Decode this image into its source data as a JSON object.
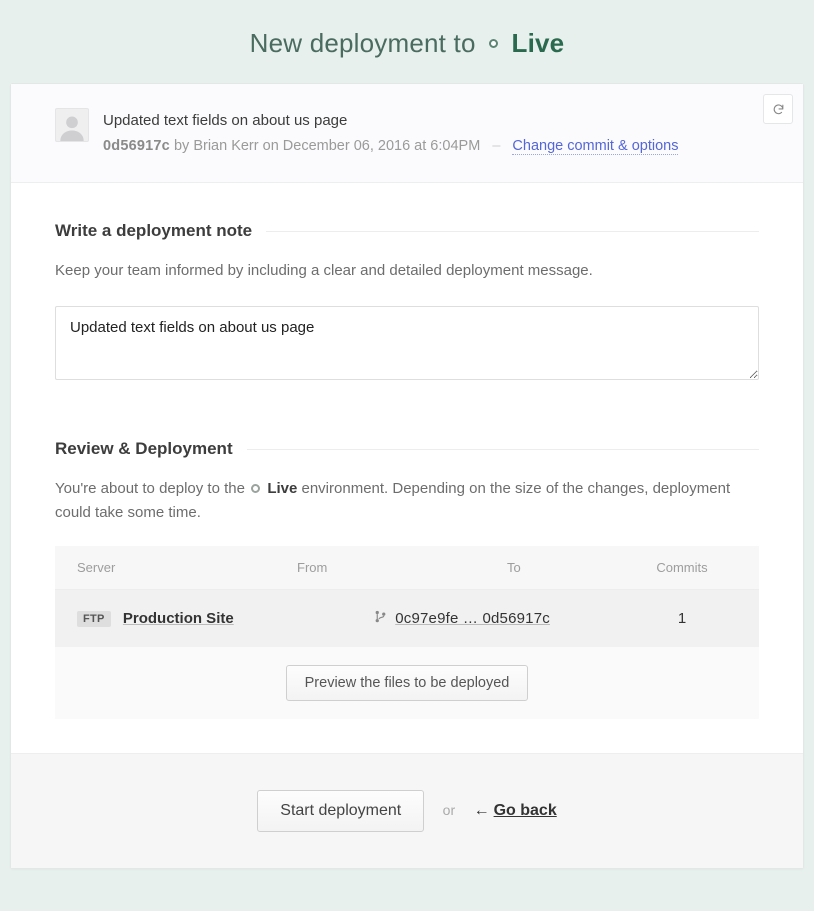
{
  "header": {
    "prefix": "New deployment to",
    "environment": "Live"
  },
  "commit": {
    "title": "Updated text fields on about us page",
    "hash": "0d56917c",
    "by_prefix": "by",
    "author": "Brian Kerr",
    "on_prefix": "on",
    "date": "December 06, 2016 at 6:04PM",
    "separator": "–",
    "change_link": "Change commit & options"
  },
  "note": {
    "heading": "Write a deployment note",
    "description": "Keep your team informed by including a clear and detailed deployment message.",
    "value": "Updated text fields on about us page"
  },
  "review": {
    "heading": "Review & Deployment",
    "desc_prefix": "You're about to deploy to the",
    "env_label": "Live",
    "desc_suffix": "environment. Depending on the size of the changes, deployment could take some time.",
    "columns": {
      "server": "Server",
      "from": "From",
      "to": "To",
      "commits": "Commits"
    },
    "row": {
      "proto": "FTP",
      "server_name": "Production Site",
      "range_text": "0c97e9fe … 0d56917c",
      "commits": "1"
    },
    "preview_btn": "Preview the files to be deployed"
  },
  "footer": {
    "start_btn": "Start deployment",
    "or": "or",
    "go_back": "Go back"
  }
}
